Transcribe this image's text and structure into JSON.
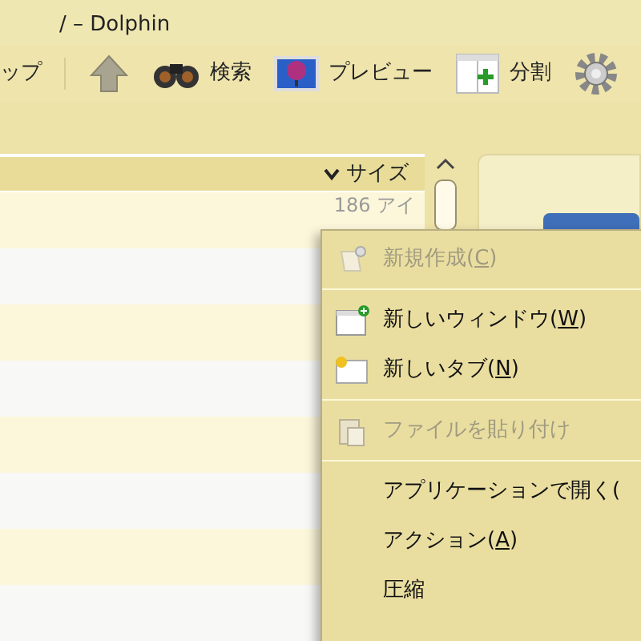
{
  "window": {
    "title": "/ – Dolphin"
  },
  "toolbar": [
    {
      "kind": "text",
      "label": "ップ"
    },
    {
      "kind": "up"
    },
    {
      "kind": "search",
      "label": "検索"
    },
    {
      "kind": "preview",
      "label": "プレビュー"
    },
    {
      "kind": "split",
      "label": "分割"
    },
    {
      "kind": "gear"
    }
  ],
  "file_list": {
    "column_header": "サイズ",
    "rows": [
      "186 アイ"
    ]
  },
  "context_menu": [
    {
      "kind": "new",
      "prefix": "新規作成(",
      "accel": "C",
      "suffix": ")",
      "disabled": true
    },
    {
      "kind": "separator"
    },
    {
      "kind": "window",
      "prefix": "新しいウィンドウ(",
      "accel": "W",
      "suffix": ")",
      "disabled": false
    },
    {
      "kind": "tab",
      "prefix": "新しいタブ(",
      "accel": "N",
      "suffix": ")",
      "disabled": false
    },
    {
      "kind": "separator"
    },
    {
      "kind": "paste",
      "prefix": "ファイルを貼り付け",
      "disabled": true
    },
    {
      "kind": "separator"
    },
    {
      "kind": "item",
      "prefix": "アプリケーションで開く(",
      "disabled": false
    },
    {
      "kind": "item",
      "prefix": "アクション(",
      "accel": "A",
      "suffix": ")",
      "disabled": false
    },
    {
      "kind": "item",
      "prefix": "圧縮",
      "disabled": false
    }
  ]
}
